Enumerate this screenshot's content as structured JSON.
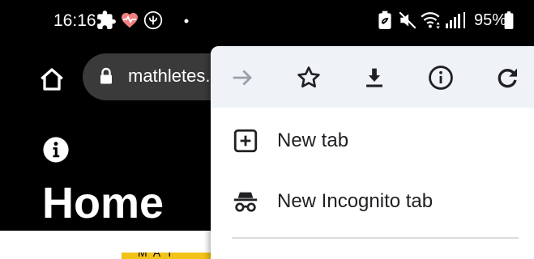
{
  "status_bar": {
    "time": "16:16",
    "battery": "95%",
    "left_icons": [
      "puzzle-icon",
      "heart-rate-icon",
      "antenna-icon",
      "notification-dot-icon"
    ],
    "right_icons": [
      "battery-saver-icon",
      "mute-icon",
      "wifi-icon",
      "signal-icon",
      "battery-icon"
    ]
  },
  "toolbar": {
    "url": "mathletes.co"
  },
  "page": {
    "heading": "Home",
    "strip_text": "M A T"
  },
  "menu": {
    "toolbar_icons": [
      "forward-arrow-icon",
      "star-icon",
      "download-icon",
      "info-icon",
      "reload-icon"
    ],
    "items": [
      {
        "label": "New tab",
        "icon": "new-tab-icon"
      },
      {
        "label": "New Incognito tab",
        "icon": "incognito-icon"
      }
    ]
  },
  "colors": {
    "page_background": "#000000",
    "menu_background": "#ffffff",
    "menu_toolbar_background": "#eff3f8",
    "url_bar_background": "#3a3a3a",
    "disabled_icon": "#9aa0a6",
    "active_icon": "#202124",
    "accent_strip": "#f2c318"
  }
}
